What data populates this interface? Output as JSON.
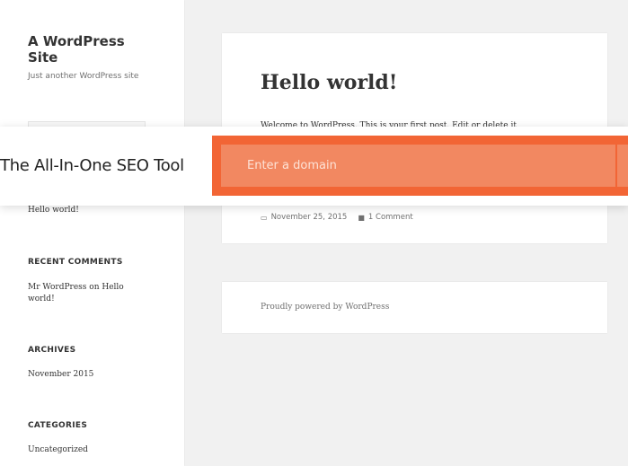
{
  "site": {
    "title": "A WordPress Site",
    "description": "Just another WordPress site"
  },
  "sidebar": {
    "recent_post": "Hello world!",
    "recent_comments_title": "RECENT COMMENTS",
    "comment_author": "Mr WordPress",
    "comment_on": " on ",
    "comment_post": "Hello world!",
    "archives_title": "ARCHIVES",
    "archive_item": "November 2015",
    "categories_title": "CATEGORIES",
    "category_item": "Uncategorized"
  },
  "post": {
    "title": "Hello world!",
    "excerpt": "Welcome to WordPress. This is your first post. Edit or delete it",
    "date": "November 25, 2015",
    "comments": "1 Comment",
    "date_icon": "calendar-icon",
    "comment_icon": "comment-icon"
  },
  "footer": {
    "text": "Proudly powered by WordPress"
  },
  "seo": {
    "tagline": "The All-In-One SEO Tool",
    "placeholder": "Enter a domain",
    "accent": "#f26535",
    "input_bg": "#f28861"
  }
}
